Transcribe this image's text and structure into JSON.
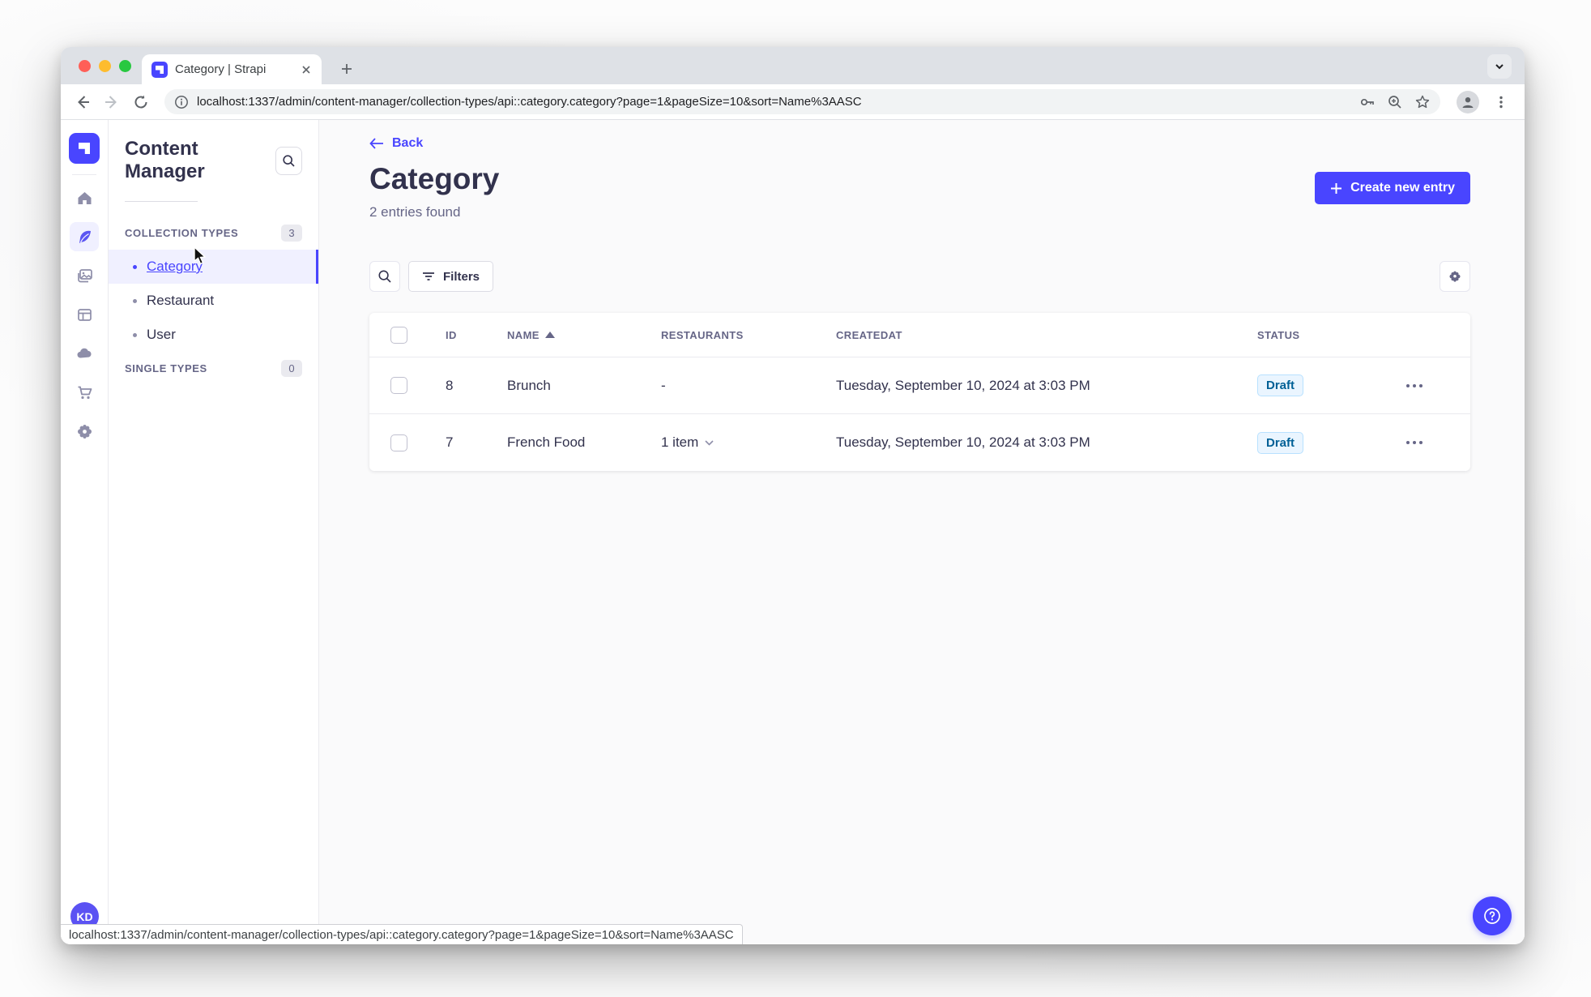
{
  "colors": {
    "accent": "#4945ff",
    "active_item_bg": "#f0f0ff",
    "text": "#32324d",
    "muted": "#666687",
    "border": "#eaeaef",
    "draft_bg": "#eaf5ff",
    "draft_border": "#b8e1ff",
    "draft_text": "#006096"
  },
  "browser": {
    "tab_title": "Category | Strapi",
    "url": "localhost:1337/admin/content-manager/collection-types/api::category.category?page=1&pageSize=10&sort=Name%3AASC",
    "status_url": "localhost:1337/admin/content-manager/collection-types/api::category.category?page=1&pageSize=10&sort=Name%3AASC"
  },
  "sidebar": {
    "title": "Content Manager",
    "collection_types": {
      "label": "COLLECTION TYPES",
      "count": "3",
      "items": [
        {
          "label": "Category"
        },
        {
          "label": "Restaurant"
        },
        {
          "label": "User"
        }
      ]
    },
    "single_types": {
      "label": "SINGLE TYPES",
      "count": "0"
    }
  },
  "header": {
    "back_label": "Back",
    "title": "Category",
    "subtitle": "2 entries found",
    "create_button_label": "Create new entry"
  },
  "filters": {
    "filters_button_label": "Filters"
  },
  "table": {
    "columns": {
      "id": "ID",
      "name": "NAME",
      "restaurants": "RESTAURANTS",
      "createdat": "CREATEDAT",
      "status": "STATUS"
    },
    "rows": [
      {
        "id": "8",
        "name": "Brunch",
        "restaurants": "-",
        "createdat": "Tuesday, September 10, 2024 at 3:03 PM",
        "status": "Draft"
      },
      {
        "id": "7",
        "name": "French Food",
        "restaurants": "1 item",
        "createdat": "Tuesday, September 10, 2024 at 3:03 PM",
        "status": "Draft"
      }
    ]
  },
  "user": {
    "initials": "KD"
  }
}
